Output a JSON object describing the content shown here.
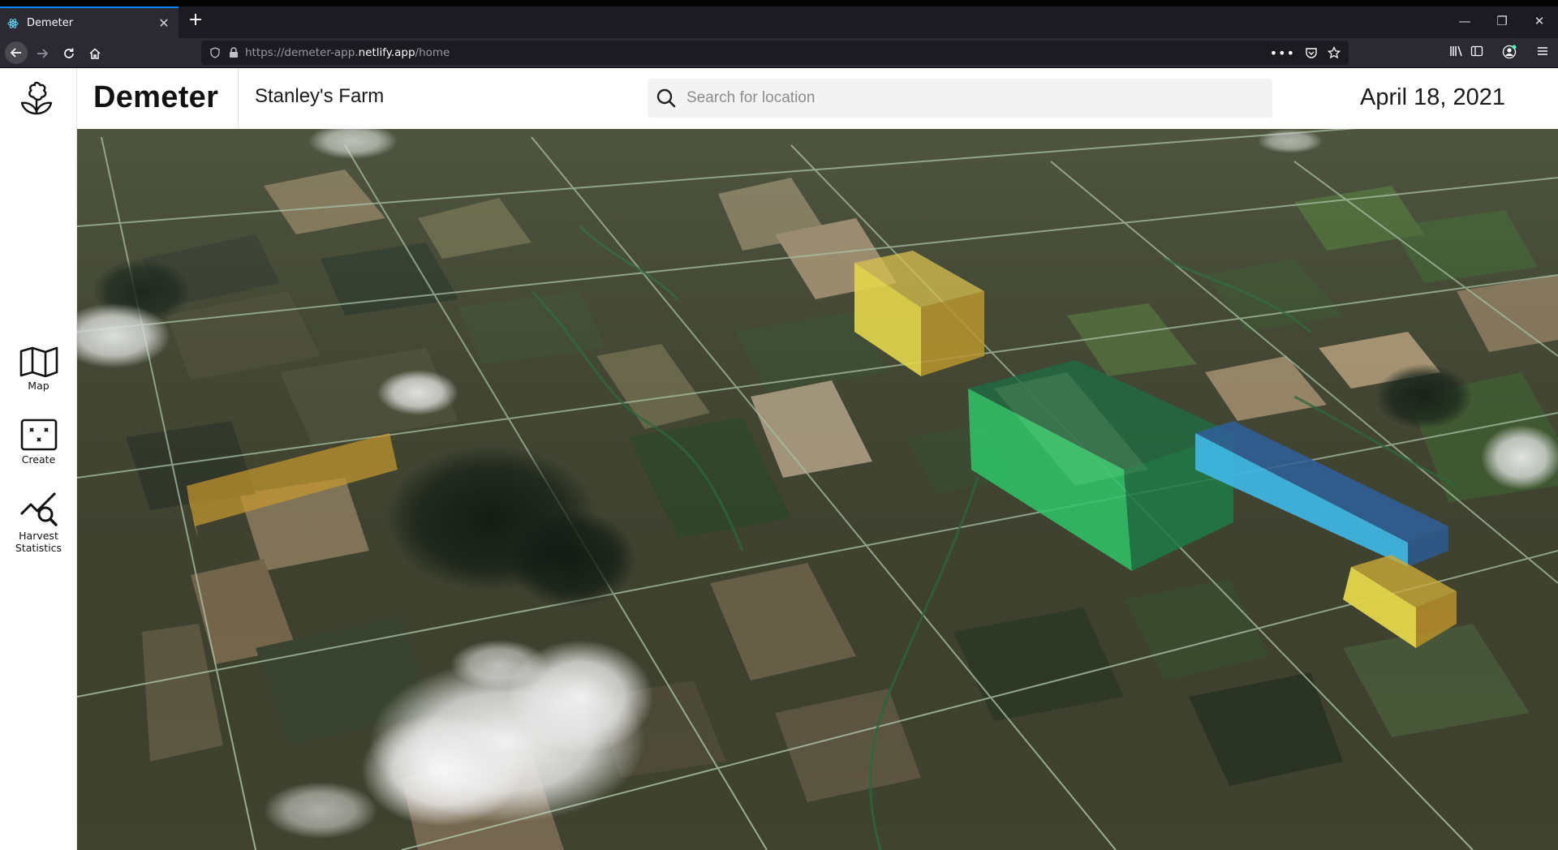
{
  "browser": {
    "tab_title": "Demeter",
    "tab_close": "✕",
    "new_tab": "+",
    "url_scheme": "https://demeter-app.",
    "url_host": "netlify.app",
    "url_path": "/home",
    "window_controls": [
      "—",
      "❐",
      "✕"
    ]
  },
  "app": {
    "brand": "Demeter",
    "farm_name": "Stanley's Farm",
    "search": {
      "placeholder": "Search for location",
      "value": ""
    },
    "date": "April 18, 2021"
  },
  "sidebar": {
    "items": [
      {
        "label": "Map",
        "icon": "map-icon"
      },
      {
        "label": "Create",
        "icon": "create-icon"
      },
      {
        "label": "Harvest\nStatistics",
        "label_line1": "Harvest",
        "label_line2": "Statistics",
        "icon": "harvest-statistics-icon"
      }
    ]
  },
  "map": {
    "view": "3D satellite farmland",
    "field_volumes": [
      {
        "color": "#e4d64a",
        "label": "yellow-volume-north"
      },
      {
        "color": "#c79a2e",
        "label": "orange-volume-west"
      },
      {
        "color": "#2fc56a",
        "label": "green-volume"
      },
      {
        "color": "#3f8fd4",
        "label": "blue-volume"
      },
      {
        "color": "#e4d64a",
        "label": "yellow-volume-east"
      }
    ]
  }
}
